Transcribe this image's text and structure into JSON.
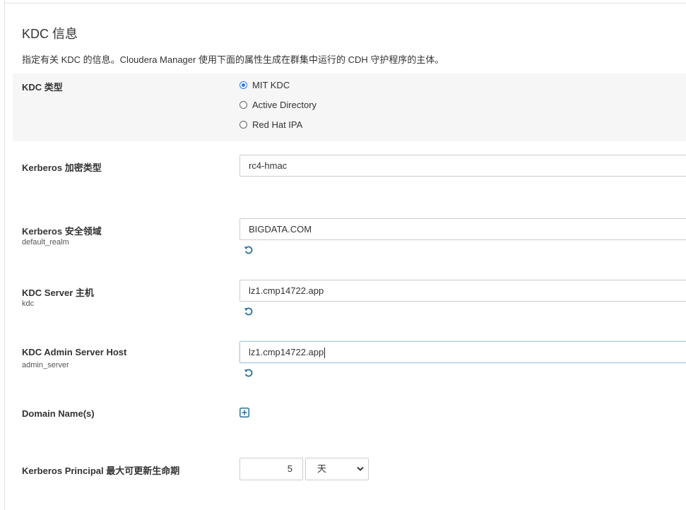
{
  "section": {
    "title": "KDC 信息",
    "description": "指定有关 KDC 的信息。Cloudera Manager 使用下面的属性生成在群集中运行的 CDH 守护程序的主体。"
  },
  "kdc_type": {
    "label": "KDC 类型",
    "options": [
      "MIT KDC",
      "Active Directory",
      "Red Hat IPA"
    ],
    "selected": "MIT KDC"
  },
  "encryption": {
    "label": "Kerberos 加密类型",
    "value": "rc4-hmac"
  },
  "realm": {
    "label": "Kerberos 安全领域",
    "sublabel": "default_realm",
    "value": "BIGDATA.COM"
  },
  "kdc_host": {
    "label": "KDC Server 主机",
    "sublabel": "kdc",
    "value": "lz1.cmp14722.app"
  },
  "admin_host": {
    "label": "KDC Admin Server Host",
    "sublabel": "admin_server",
    "value": "lz1.cmp14722.app"
  },
  "domains": {
    "label": "Domain Name(s)"
  },
  "renew": {
    "label": "Kerberos Principal 最大可更新生命期",
    "value": "5",
    "unit": "天"
  },
  "colors": {
    "accent": "#2a7ad8",
    "icon": "#2a6f97",
    "row_bg": "#f6f6f6"
  },
  "icons": [
    "undo-icon",
    "plus-square-icon",
    "chevron-down-icon"
  ]
}
